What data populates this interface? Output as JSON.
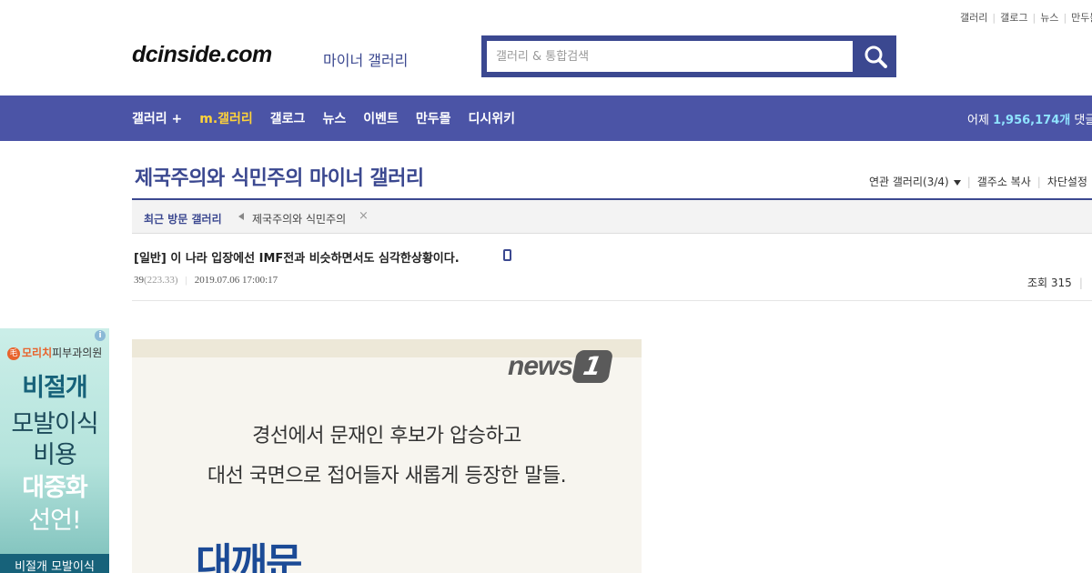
{
  "top_links": [
    "갤러리",
    "갤로그",
    "뉴스",
    "만두몰"
  ],
  "logo": {
    "text": "dcinside.com",
    "sub": "마이너 갤러리"
  },
  "search": {
    "placeholder": "갤러리 & 통합검색",
    "icon": "search-icon"
  },
  "nav": {
    "items": [
      "갤러리 +",
      "m.갤러리",
      "갤로그",
      "뉴스",
      "이벤트",
      "만두몰",
      "디시위키"
    ],
    "active_index": 1,
    "visit_prefix": "어제",
    "visit_count": "1,956,174개",
    "visit_suffix": "댓글"
  },
  "gallery": {
    "title": "제국주의와 식민주의 마이너 갤러리",
    "links": [
      "연관 갤러리(3/4)",
      "갤주소 복사",
      "차단설정"
    ]
  },
  "recent": {
    "label": "최근 방문 갤러리",
    "items": [
      "제국주의와 식민주의"
    ],
    "close": "×"
  },
  "post": {
    "title": "[일반] 이 나라 입장에선 IMF전과 비슷하면서도 심각한상황이다.",
    "author": "39",
    "ip": "(223.33)",
    "date": "2019.07.06 17:00:17",
    "views_label": "조회 315"
  },
  "ad": {
    "info": "i",
    "brand_mark": "毛",
    "brand_highlight": "모리치",
    "brand_rest": "피부과의원",
    "lines": [
      "비절개",
      "모발이식",
      "비용",
      "대중화",
      "선언!"
    ],
    "bottom": "비절개 모발이식"
  },
  "article_image": {
    "logo_word": "news",
    "logo_number": "1",
    "line1": "경선에서 문재인 후보가 압승하고",
    "line2": "대선 국면으로 접어들자 새롭게 등장한 말들.",
    "big": "대깨문"
  },
  "colors": {
    "brand_blue": "#3b4890",
    "nav_blue": "#4b54a6",
    "active_yellow": "#ffd33a",
    "count_cyan": "#8fe3ff"
  }
}
